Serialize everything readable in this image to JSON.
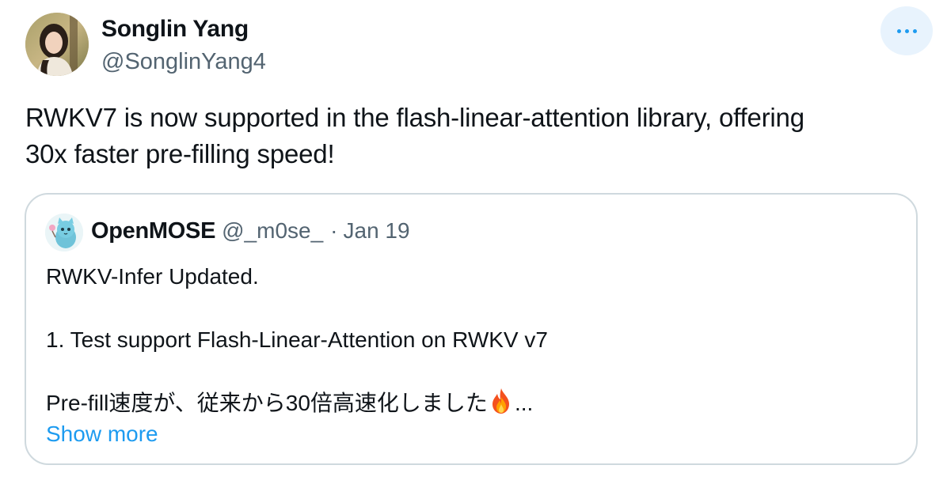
{
  "author": {
    "name": "Songlin Yang",
    "handle": "@SonglinYang4"
  },
  "more_button": {
    "icon": "more-horizontal-icon",
    "accent_color": "#1d9bf0"
  },
  "tweet": {
    "lines": [
      "RWKV7 is now supported in the flash-linear-attention library, offering",
      "30x faster pre-filling speed!"
    ]
  },
  "quoted_tweet": {
    "author_name": "OpenMOSE",
    "author_handle": "@_m0se_",
    "separator": "·",
    "date": "Jan 19",
    "line1": "RWKV-Infer Updated.",
    "line2": "1. Test support Flash-Linear-Attention on RWKV v7",
    "line3_text": "Pre-fill速度が、従来から30倍高速化しました",
    "line3_emoji": "fire-emoji",
    "line3_ellipsis": "...",
    "show_more": "Show more"
  },
  "colors": {
    "text": "#0f1419",
    "secondary": "#536471",
    "link": "#1d9bf0",
    "border": "#cfd9de"
  }
}
